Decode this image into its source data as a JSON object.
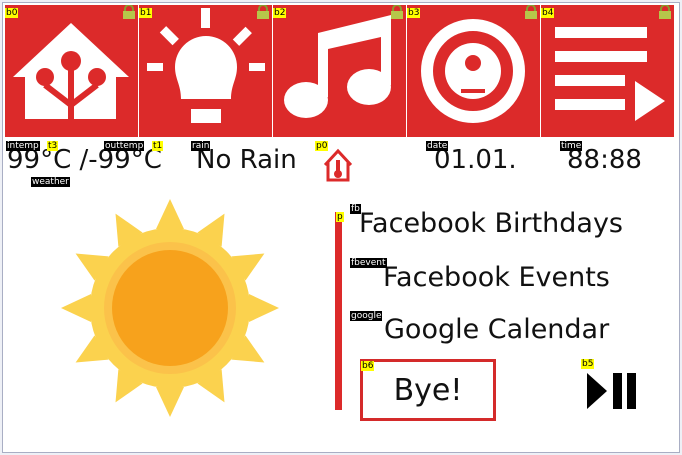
{
  "buttons": [
    {
      "tag": "b0",
      "icon": "home-assistant-icon"
    },
    {
      "tag": "b1",
      "icon": "lightbulb-icon"
    },
    {
      "tag": "b2",
      "icon": "music-note-icon"
    },
    {
      "tag": "b3",
      "icon": "vacuum-robot-icon"
    },
    {
      "tag": "b4",
      "icon": "playlist-play-icon"
    }
  ],
  "labels": {
    "intemp_tag": "intemp",
    "t3_tag": "t3",
    "outtemp_tag": "outtemp",
    "t1_tag": "t1",
    "rain_tag": "rain",
    "p0_tag": "p0",
    "date_tag": "date",
    "time_tag": "time",
    "weather_tag": "weather",
    "p_tag": "p",
    "fb_tag": "fb",
    "fbevent_tag": "fbevent",
    "google_tag": "google",
    "b6_tag": "b6",
    "b5_tag": "b5"
  },
  "status": {
    "temperature": "99°C /-99°C",
    "rain": "No Rain",
    "date": "01.01.",
    "time": "88:88"
  },
  "calendars": {
    "fb": "Facebook Birthdays",
    "fbevent": "Facebook Events",
    "google": "Google Calendar"
  },
  "bye_label": "Bye!",
  "weather_icon": "sun-icon",
  "colors": {
    "accent": "#dc2a2a",
    "sun_outer": "#fbd24e",
    "sun_inner": "#f7a21c"
  }
}
